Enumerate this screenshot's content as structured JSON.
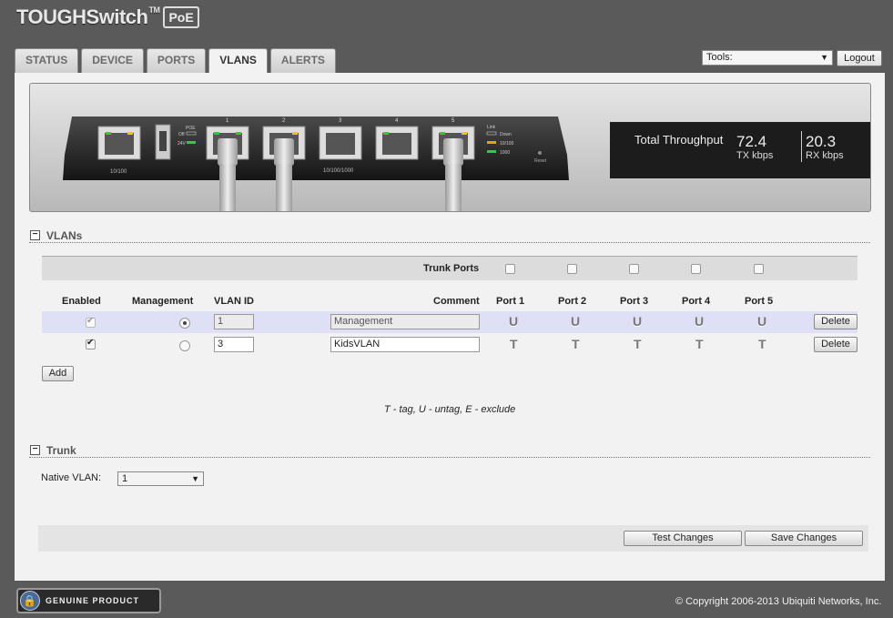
{
  "header": {
    "logo_main": "TOUGHSwitch",
    "logo_tm": "TM",
    "logo_badge": "PoE"
  },
  "tabs": [
    {
      "label": "STATUS"
    },
    {
      "label": "DEVICE"
    },
    {
      "label": "PORTS"
    },
    {
      "label": "VLANS",
      "active": true
    },
    {
      "label": "ALERTS"
    }
  ],
  "tools": {
    "label": "Tools:"
  },
  "logout_label": "Logout",
  "device": {
    "port_labels": [
      "1",
      "2",
      "3",
      "4",
      "5"
    ],
    "label_10_100": "10/100",
    "label_10_100_1000": "10/100/1000",
    "poe_label": "POE",
    "poe_off": "Off",
    "poe_24v": "24V",
    "link_label": "Link",
    "link_down": "Down",
    "link_10_100": "10/100",
    "link_1000": "1000",
    "reset_label": "Reset"
  },
  "throughput": {
    "title": "Total Throughput",
    "tx_value": "72.4",
    "tx_label": "TX kbps",
    "rx_value": "20.3",
    "rx_label": "RX kbps"
  },
  "vlans_section": {
    "title": "VLANs",
    "trunk_ports_label": "Trunk Ports",
    "trunk_checked": [
      false,
      false,
      false,
      false,
      false
    ],
    "headers": {
      "enabled": "Enabled",
      "management": "Management",
      "vlan_id": "VLAN ID",
      "comment": "Comment",
      "ports": [
        "Port 1",
        "Port 2",
        "Port 3",
        "Port 4",
        "Port 5"
      ]
    },
    "rows": [
      {
        "enabled": true,
        "management": true,
        "vlan_id": "1",
        "comment": "Management",
        "ports": [
          "U",
          "U",
          "U",
          "U",
          "U"
        ],
        "delete": "Delete"
      },
      {
        "enabled": true,
        "management": false,
        "vlan_id": "3",
        "comment": "KidsVLAN",
        "ports": [
          "T",
          "T",
          "T",
          "T",
          "T"
        ],
        "delete": "Delete"
      }
    ],
    "add_label": "Add",
    "legend": "T - tag, U - untag, E - exclude"
  },
  "trunk_section": {
    "title": "Trunk",
    "native_vlan_label": "Native VLAN:",
    "native_vlan_value": "1"
  },
  "actions": {
    "test_label": "Test Changes",
    "save_label": "Save Changes"
  },
  "footer": {
    "genuine_text": "GENUINE PRODUCT",
    "copyright": "© Copyright 2006-2013 Ubiquiti Networks, Inc."
  }
}
